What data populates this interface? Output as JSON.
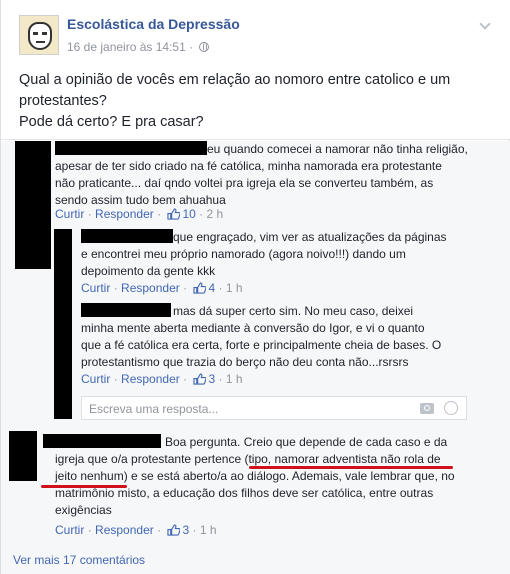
{
  "post": {
    "page_name": "Escolástica da Depressão",
    "timestamp": "16 de janeiro às 14:51 ·",
    "line1": "Qual a opinião de vocês em relação ao nomoro entre catolico e um",
    "line2": "protestantes?",
    "line3": "Pode dá certo? E pra casar?"
  },
  "actions": {
    "like": "Curtir",
    "reply": "Responder",
    "sep": "·"
  },
  "comments": [
    {
      "lines": [
        "eu quando comecei a namorar não tinha religião,",
        "apesar de ter sido criado na fé católica, minha namorada era protestante",
        "não praticante... daí qndo voltei pra igreja ela se converteu também, as",
        "sendo assim tudo bem ahuahua"
      ],
      "likes": "10",
      "time": "2 h"
    },
    {
      "lines": [
        "que engraçado, vim ver as atualizações da páginas",
        "e encontrei meu próprio namorado (agora noivo!!!) dando um",
        "depoimento da gente kkk"
      ],
      "likes": "4",
      "time": "1 h"
    },
    {
      "lines": [
        "mas dá super certo sim. No meu caso, deixei",
        "minha mente aberta mediante à conversão do Igor, e vi o quanto",
        "que a fé católica era certa, forte e principalmente cheia de bases. O",
        "protestantismo que trazia do berço não deu conta não...rsrsrs"
      ],
      "likes": "3",
      "time": "1 h"
    },
    {
      "lines": [
        "Boa pergunta. Creio que depende de cada caso e da",
        "igreja que o/a protestante pertence (tipo, namorar adventista não rola de",
        "jeito nenhum) e se está aberto/a ao diálogo. Ademais, vale lembrar que, no",
        "matrimônio misto, a educação dos filhos deve ser católica, entre outras",
        "exigências"
      ],
      "likes": "3",
      "time": "1 h"
    }
  ],
  "reply_box": {
    "placeholder": "Escreva uma resposta..."
  },
  "see_more": "Ver mais 17 comentários",
  "colors": {
    "link": "#4267b2",
    "page_name": "#365899",
    "annotation": "#d0101a"
  }
}
